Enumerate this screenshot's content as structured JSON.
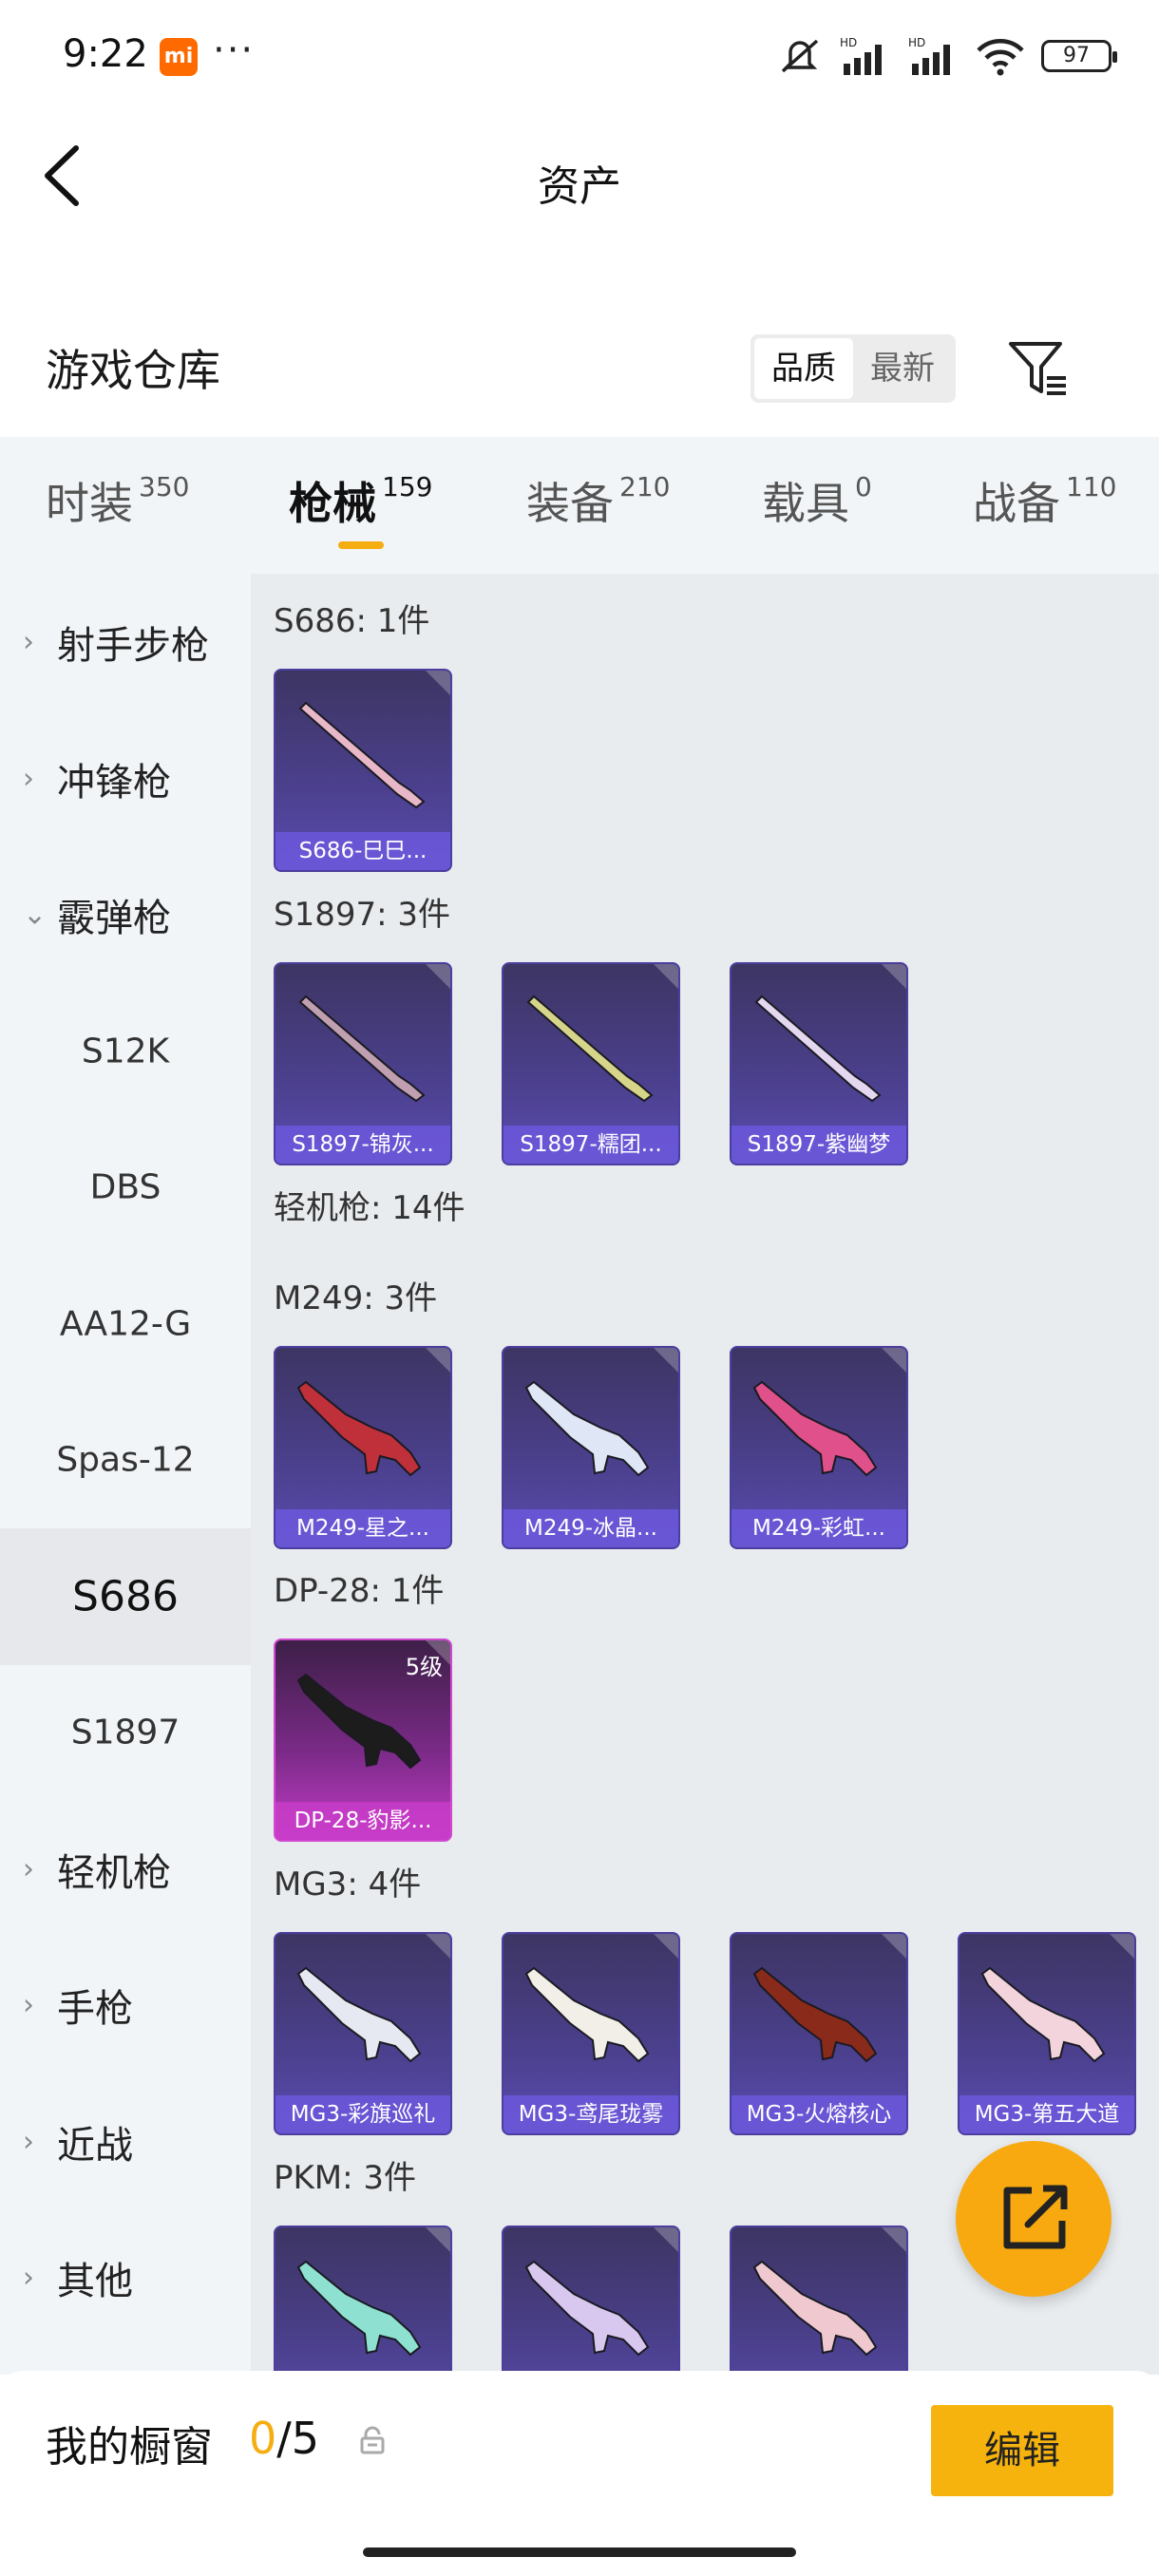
{
  "status": {
    "time": "9:22",
    "mi_badge": "mi",
    "dots": "···",
    "battery": "97"
  },
  "nav": {
    "title": "资产"
  },
  "warehouse": {
    "title": "游戏仓库",
    "sort": [
      {
        "label": "品质",
        "active": true
      },
      {
        "label": "最新",
        "active": false
      }
    ]
  },
  "tabs": [
    {
      "label": "时装",
      "count": "350"
    },
    {
      "label": "枪械",
      "count": "159",
      "active": true
    },
    {
      "label": "装备",
      "count": "210"
    },
    {
      "label": "载具",
      "count": "0"
    },
    {
      "label": "战备",
      "count": "110"
    }
  ],
  "sidebar": [
    {
      "label": "射手步枪",
      "arrow": "›"
    },
    {
      "label": "冲锋枪",
      "arrow": "›"
    },
    {
      "label": "霰弹枪",
      "arrow": "⌄"
    },
    {
      "label": "S12K"
    },
    {
      "label": "DBS"
    },
    {
      "label": "AA12-G"
    },
    {
      "label": "Spas-12"
    },
    {
      "label": "S686",
      "selected": true
    },
    {
      "label": "S1897"
    },
    {
      "label": "轻机枪",
      "arrow": "›"
    },
    {
      "label": "手枪",
      "arrow": "›"
    },
    {
      "label": "近战",
      "arrow": "›"
    },
    {
      "label": "其他",
      "arrow": "›"
    }
  ],
  "groups": [
    {
      "title": "S686: 1件",
      "items": [
        {
          "name": "S686-巳巳...",
          "color": "#e8b8c8"
        }
      ]
    },
    {
      "title": "S1897: 3件",
      "items": [
        {
          "name": "S1897-锦灰...",
          "color": "#c0a0b0"
        },
        {
          "name": "S1897-糯团...",
          "color": "#d6d58a"
        },
        {
          "name": "S1897-紫幽梦",
          "color": "#e4d8f0"
        }
      ]
    },
    {
      "title": "轻机枪: 14件",
      "items": []
    },
    {
      "title": "M249: 3件",
      "items": [
        {
          "name": "M249-星之...",
          "color": "#c0303a"
        },
        {
          "name": "M249-冰晶...",
          "color": "#dfe6f5"
        },
        {
          "name": "M249-彩虹...",
          "color": "#e0508a"
        }
      ]
    },
    {
      "title": "DP-28: 1件",
      "items": [
        {
          "name": "DP-28-豹影...",
          "color": "#1c1c1c",
          "level": "5级",
          "pink": true
        }
      ]
    },
    {
      "title": "MG3: 4件",
      "items": [
        {
          "name": "MG3-彩旗巡礼",
          "color": "#e6e8f2"
        },
        {
          "name": "MG3-鸢尾珑雾",
          "color": "#f2efe8"
        },
        {
          "name": "MG3-火熔核心",
          "color": "#8a2a1a"
        },
        {
          "name": "MG3-第五大道",
          "color": "#f3d4dc"
        }
      ]
    },
    {
      "title": "PKM: 3件",
      "items": [
        {
          "name": "",
          "color": "#8ee0d0"
        },
        {
          "name": "",
          "color": "#d8c8f0"
        },
        {
          "name": "",
          "color": "#f0c8d0"
        }
      ]
    }
  ],
  "bottom": {
    "label": "我的橱窗",
    "count_current": "0",
    "count_total": "/5",
    "edit_label": "编辑"
  },
  "accent": "#f5ad11"
}
